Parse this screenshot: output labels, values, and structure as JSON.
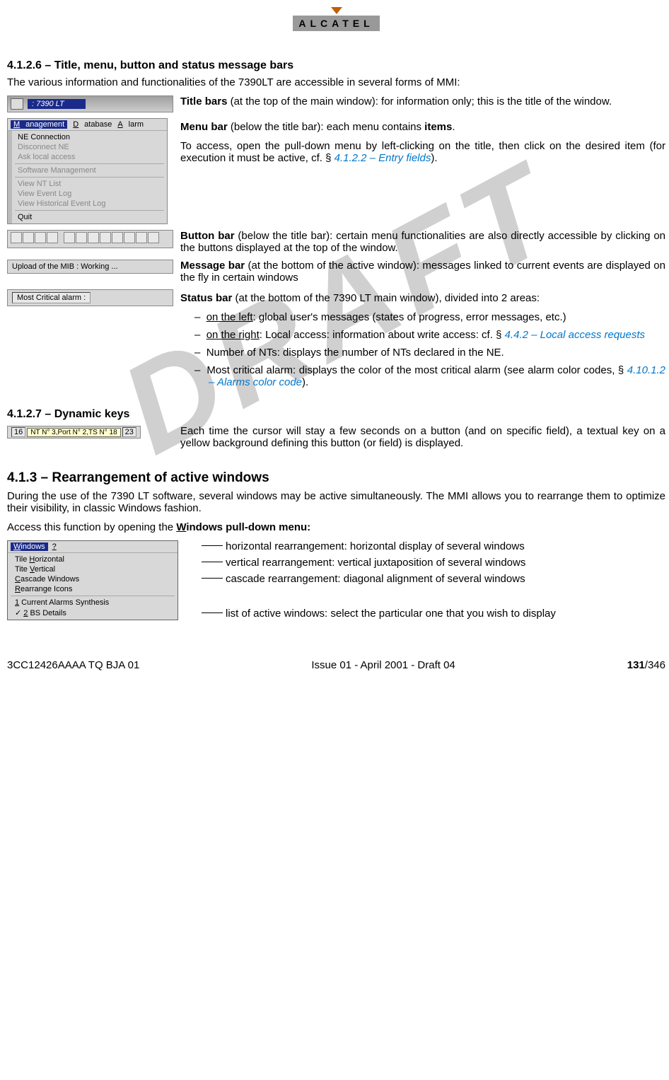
{
  "brand": "ALCATEL",
  "section_41266": {
    "num": "4.1.2.6 – ",
    "title": "Title, menu, button and status message bars",
    "intro": "The various information and functionalities of the 7390LT are accessible in several forms of MMI:"
  },
  "titlebar": {
    "demo_title": "7390 LT",
    "label_bold": "Title bars",
    "label_rest": " (at the top of the main window): for information only; this is the title of the window."
  },
  "menubar": {
    "bar_items": {
      "a": "Management",
      "b": "Database",
      "c": "Alarm"
    },
    "items": {
      "i1": "NE Connection",
      "i2": "Disconnect NE",
      "i3": "Ask local access",
      "i4": "Software Management",
      "i5": "View NT List",
      "i6": "View Event Log",
      "i7": "View Historical Event Log",
      "i8": "Quit"
    },
    "label_bold": "Menu bar",
    "label_1": " (below the title bar): each menu contains ",
    "label_items": "items",
    "label_2": ".",
    "para2_a": "To access, open the pull-down menu by left-clicking on the title, then click on the desired item (for execution it must be active, cf. § ",
    "link": "4.1.2.2 – Entry fields",
    "para2_b": ")."
  },
  "buttonbar": {
    "label_bold": "Button bar",
    "label_rest": " (below the title bar): certain menu functionalities are also directly accessible by clicking on the buttons displayed at the top of the window."
  },
  "msgbar": {
    "demo_text": "Upload of the MIB : Working ...",
    "label_bold": "Message bar",
    "label_rest": " (at the bottom of the active window): messages linked to current events are displayed on the fly in certain windows"
  },
  "statusbar": {
    "demo_text": "Most Critical alarm :",
    "label_bold": "Status bar",
    "label_rest": " (at the bottom of the 7390 LT main window), divided into 2 areas:",
    "li1_a": "on the left",
    "li1_b": ": global user's messages (states of progress, error messages, etc.)",
    "li2_a": "on the right",
    "li2_b": ": Local access: information about write access: cf. §  ",
    "li2_link": "4.4.2 – Local access requests",
    "li3": "Number of NTs: displays the number of NTs declared in the NE.",
    "li4_a": "Most critical alarm: displays the color of the most critical alarm (see alarm color codes, § ",
    "li4_link": "4.10.1.2 – Alarms color code",
    "li4_b": ")."
  },
  "section_41267": {
    "num": "4.1.2.7 – ",
    "title": "Dynamic keys",
    "demo": {
      "left_num": "16",
      "tip": "NT N° 3,Port N° 2,TS N° 18",
      "right_num": "23"
    },
    "para": "Each time the cursor will stay a few seconds on a button (and on specific field), a textual key on a yellow background defining this button (or field) is displayed."
  },
  "section_413": {
    "num": "4.1.3 – ",
    "title": "Rearrangement of active windows",
    "p1": "During the use of the 7390 LT software, several windows may be active simultaneously. The MMI allows you to rearrange them to optimize their visibility, in classic Windows fashion.",
    "p2_a": "Access this function by opening the ",
    "p2_u": "W",
    "p2_b": "indows pull-down menu:"
  },
  "windows_menu": {
    "bar_a": "Windows",
    "bar_b": "?",
    "items": {
      "i1": "Tile Horizontal",
      "i2": "Tite Vertical",
      "i3": "Cascade Windows",
      "i4": "Rearrange Icons",
      "i5": "1 Current Alarms Synthesis",
      "i6": "2 BS Details"
    },
    "annot": {
      "a1": "horizontal rearrangement: horizontal display of several windows",
      "a2": "vertical rearrangement: vertical juxtaposition of several windows",
      "a3": "cascade rearrangement: diagonal alignment of several windows",
      "a4": "list of active windows: select the particular one that you wish to display"
    }
  },
  "footer": {
    "left": "3CC12426AAAA TQ BJA 01",
    "center": "Issue 01 - April 2001 - Draft 04",
    "page_cur": "131",
    "page_total": "/346"
  },
  "watermark": "DRAFT"
}
